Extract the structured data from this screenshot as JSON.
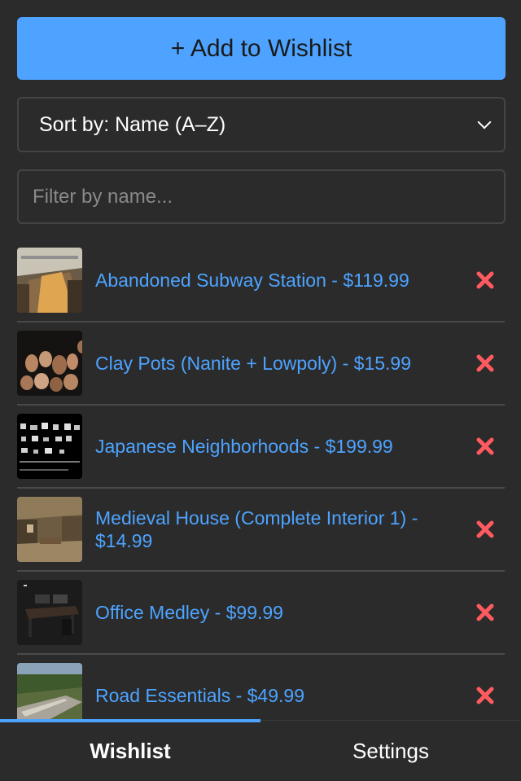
{
  "add_button": {
    "label": "+ Add to Wishlist"
  },
  "sort": {
    "label": "Sort by: Name (A–Z)",
    "icon": "chevron-down-icon"
  },
  "filter": {
    "placeholder": "Filter by name...",
    "value": ""
  },
  "items": [
    {
      "label": "Abandoned Subway Station - $119.99",
      "thumb": "subway"
    },
    {
      "label": "Clay Pots (Nanite + Lowpoly) - $15.99",
      "thumb": "pots"
    },
    {
      "label": "Japanese Neighborhoods - $199.99",
      "thumb": "japan"
    },
    {
      "label": "Medieval House (Complete Interior 1) - $14.99",
      "thumb": "medieval"
    },
    {
      "label": "Office Medley - $99.99",
      "thumb": "office"
    },
    {
      "label": "Road Essentials - $49.99",
      "thumb": "road"
    }
  ],
  "remove_icon": "close-x-icon",
  "tabs": [
    {
      "label": "Wishlist",
      "active": true
    },
    {
      "label": "Settings",
      "active": false
    }
  ],
  "colors": {
    "background": "#2b2b2b",
    "accent": "#4da3ff",
    "remove": "#ff5a5f",
    "border": "#444444"
  }
}
